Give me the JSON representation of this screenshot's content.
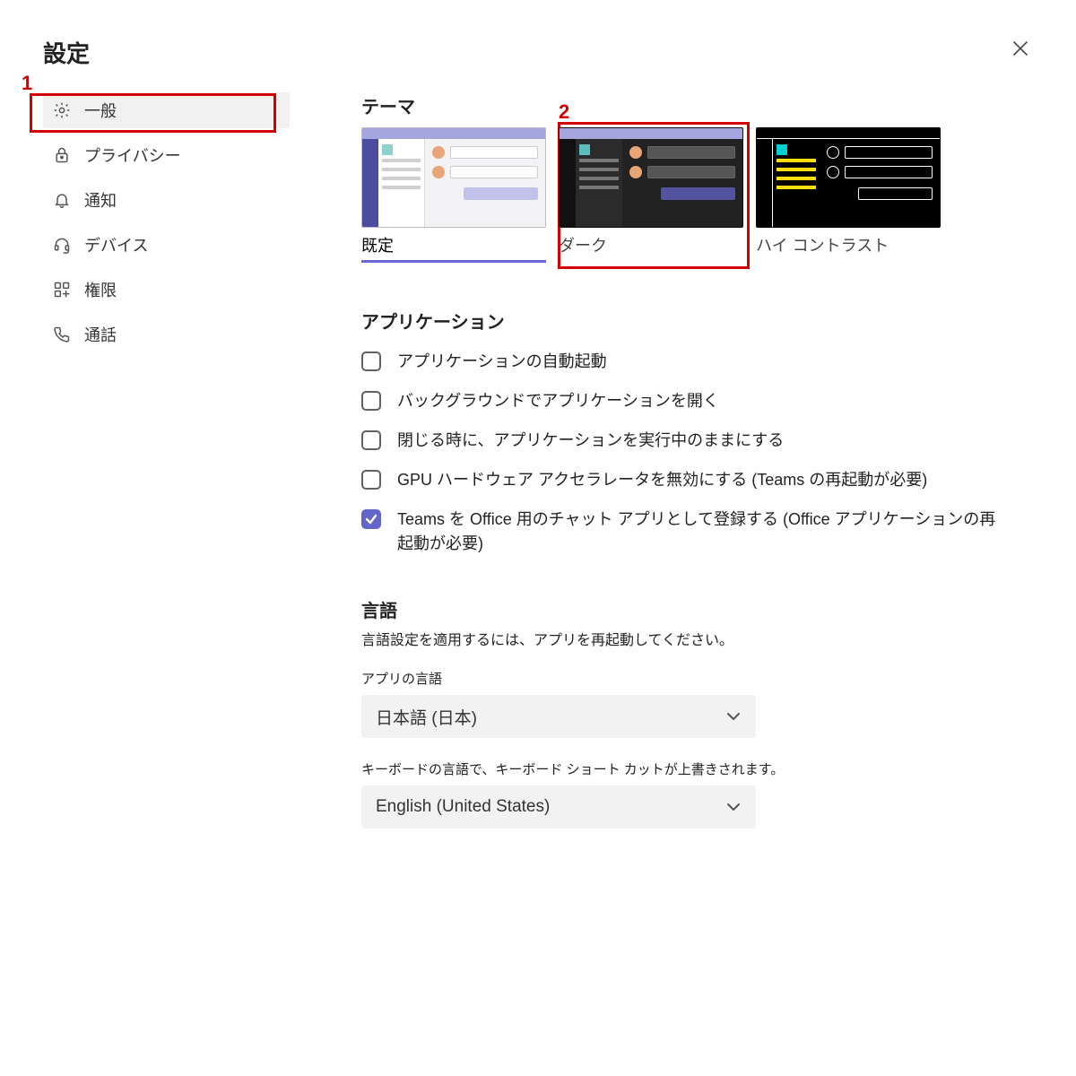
{
  "title": "設定",
  "sidebar": [
    {
      "key": "general",
      "label": "一般",
      "icon": "gear",
      "selected": true
    },
    {
      "key": "privacy",
      "label": "プライバシー",
      "icon": "lock",
      "selected": false
    },
    {
      "key": "notify",
      "label": "通知",
      "icon": "bell",
      "selected": false
    },
    {
      "key": "device",
      "label": "デバイス",
      "icon": "headset",
      "selected": false
    },
    {
      "key": "perm",
      "label": "権限",
      "icon": "apps",
      "selected": false
    },
    {
      "key": "calls",
      "label": "通話",
      "icon": "phone",
      "selected": false
    }
  ],
  "theme": {
    "heading": "テーマ",
    "options": [
      {
        "key": "default",
        "label": "既定",
        "selected": true
      },
      {
        "key": "dark",
        "label": "ダーク",
        "selected": false
      },
      {
        "key": "contrast",
        "label": "ハイ コントラスト",
        "selected": false
      }
    ]
  },
  "application": {
    "heading": "アプリケーション",
    "items": [
      {
        "checked": false,
        "label": "アプリケーションの自動起動"
      },
      {
        "checked": false,
        "label": "バックグラウンドでアプリケーションを開く"
      },
      {
        "checked": false,
        "label": "閉じる時に、アプリケーションを実行中のままにする"
      },
      {
        "checked": false,
        "label": "GPU ハードウェア アクセラレータを無効にする (Teams の再起動が必要)"
      },
      {
        "checked": true,
        "label": "Teams を Office 用のチャット アプリとして登録する (Office アプリケーションの再起動が必要)"
      }
    ]
  },
  "language": {
    "heading": "言語",
    "hint": "言語設定を適用するには、アプリを再起動してください。",
    "app_label": "アプリの言語",
    "app_value": "日本語 (日本)",
    "kb_label": "キーボードの言語で、キーボード ショート カットが上書きされます。",
    "kb_value": "English (United States)"
  },
  "callouts": {
    "one": "1",
    "two": "2"
  },
  "colors": {
    "accent": "#6365c9",
    "callout": "#d40000"
  }
}
